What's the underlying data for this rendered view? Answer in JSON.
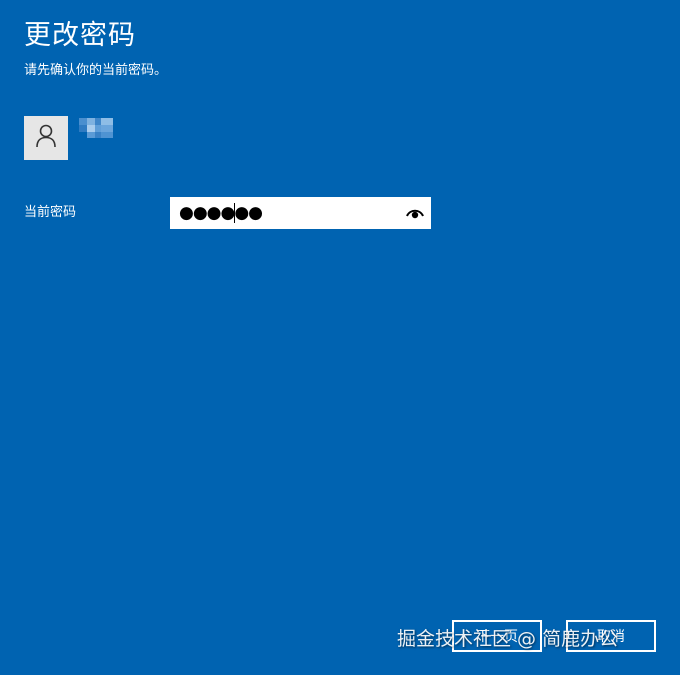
{
  "dialog": {
    "title": "更改密码",
    "subtitle": "请先确认你的当前密码。"
  },
  "user": {
    "avatar_icon": "user-avatar-icon",
    "name_redacted": true
  },
  "form": {
    "current_password_label": "当前密码",
    "current_password_value": "●●●●●●",
    "reveal_icon": "eye-icon"
  },
  "buttons": {
    "next_label": "下一页",
    "cancel_label": "取消"
  },
  "watermark": {
    "text": "掘金技术社区 @ 简鹿办公"
  },
  "colors": {
    "background": "#0063b1",
    "text": "#ffffff",
    "field_background": "#ffffff"
  }
}
